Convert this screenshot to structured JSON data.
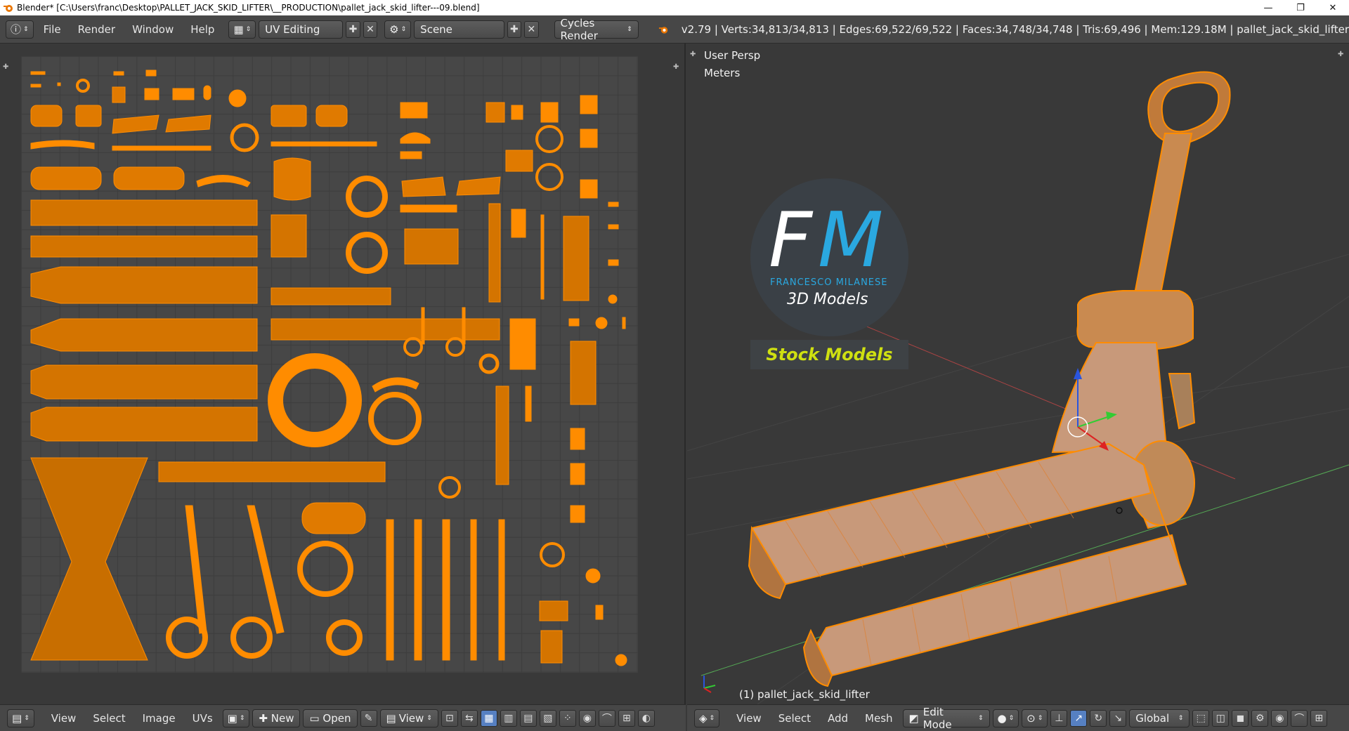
{
  "window": {
    "title": "Blender* [C:\\Users\\franc\\Desktop\\PALLET_JACK_SKID_LIFTER\\__PRODUCTION\\pallet_jack_skid_lifter---09.blend]",
    "minimize": "—",
    "maximize": "❐",
    "close": "✕"
  },
  "topbar": {
    "info_icon": "info-icon",
    "menus": [
      "File",
      "Render",
      "Window",
      "Help"
    ],
    "screen_layout": "UV Editing",
    "scene": "Scene",
    "render_engine": "Cycles Render",
    "stats": "v2.79 | Verts:34,813/34,813 | Edges:69,522/69,522 | Faces:34,748/34,748 | Tris:69,496 | Mem:129.18M | pallet_jack_skid_lifter"
  },
  "view3d": {
    "view_name": "User Persp",
    "units": "Meters",
    "object_label": "(1) pallet_jack_skid_lifter"
  },
  "logo": {
    "letter_f": "F",
    "letter_m": "M",
    "name": "FRANCESCO MILANESE",
    "subtitle": "3D Models",
    "banner": "Stock Models"
  },
  "uv_header": {
    "menus": [
      "View",
      "Select",
      "Image",
      "UVs"
    ],
    "new_label": "New",
    "open_label": "Open",
    "view_label": "View"
  },
  "view3d_header": {
    "menus": [
      "View",
      "Select",
      "Add",
      "Mesh"
    ],
    "mode": "Edit Mode",
    "orientation": "Global"
  },
  "colors": {
    "mesh_orange": "#ff8c00",
    "uv_background": "#474747",
    "header": "#474747"
  }
}
